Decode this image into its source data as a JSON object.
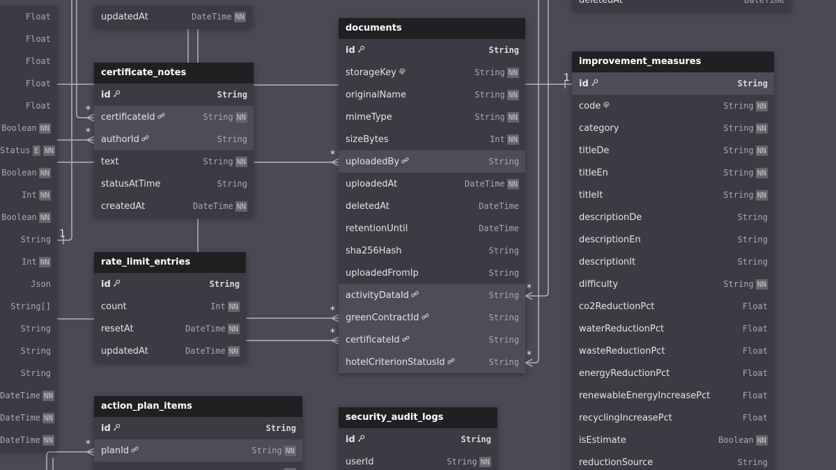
{
  "tables": {
    "partial_left": {
      "rows": [
        {
          "name": "",
          "type": "Float",
          "nn": false
        },
        {
          "name": "",
          "type": "Float",
          "nn": false
        },
        {
          "name": "",
          "type": "Float",
          "nn": false
        },
        {
          "name": "",
          "type": "Float",
          "nn": false
        },
        {
          "name": "",
          "type": "Float",
          "nn": false
        },
        {
          "name": "",
          "type": "Boolean",
          "nn": true
        },
        {
          "name": "",
          "type": "Status",
          "enum": "E",
          "nn": true
        },
        {
          "name": "",
          "type": "Boolean",
          "nn": true
        },
        {
          "name": "",
          "type": "Int",
          "nn": true
        },
        {
          "name": "",
          "type": "Boolean",
          "nn": true
        },
        {
          "name": "",
          "type": "String",
          "nn": false
        },
        {
          "name": "",
          "type": "Int",
          "nn": true
        },
        {
          "name": "",
          "type": "Json",
          "nn": false
        },
        {
          "name": "",
          "type": "String[]",
          "nn": false
        },
        {
          "name": "",
          "type": "String",
          "nn": false
        },
        {
          "name": "",
          "type": "String",
          "nn": false
        },
        {
          "name": "",
          "type": "String",
          "nn": false
        },
        {
          "name": "",
          "type": "DateTime",
          "nn": true
        },
        {
          "name": "",
          "type": "DateTime",
          "nn": true
        },
        {
          "name": "",
          "type": "DateTime",
          "nn": true
        }
      ]
    },
    "partial_top_left": {
      "rows": [
        {
          "name": "updatedAt",
          "type": "DateTime",
          "nn": true
        }
      ]
    },
    "partial_top_right": {
      "rows": [
        {
          "name": "deletedAt",
          "type": "DateTime",
          "nn": false
        }
      ]
    },
    "certificate_notes": {
      "title": "certificate_notes",
      "rows": [
        {
          "name": "id",
          "type": "String",
          "pk": true,
          "icon": "key"
        },
        {
          "name": "certificateId",
          "type": "String",
          "nn": true,
          "icon": "link",
          "hl": true
        },
        {
          "name": "authorId",
          "type": "String",
          "icon": "link",
          "hl": true
        },
        {
          "name": "text",
          "type": "String",
          "nn": true
        },
        {
          "name": "statusAtTime",
          "type": "String"
        },
        {
          "name": "createdAt",
          "type": "DateTime",
          "nn": true
        }
      ]
    },
    "documents": {
      "title": "documents",
      "rows": [
        {
          "name": "id",
          "type": "String",
          "pk": true,
          "icon": "key"
        },
        {
          "name": "storageKey",
          "type": "String",
          "nn": true,
          "icon": "fingerprint"
        },
        {
          "name": "originalName",
          "type": "String",
          "nn": true
        },
        {
          "name": "mimeType",
          "type": "String",
          "nn": true
        },
        {
          "name": "sizeBytes",
          "type": "Int",
          "nn": true
        },
        {
          "name": "uploadedBy",
          "type": "String",
          "icon": "link",
          "hl": true
        },
        {
          "name": "uploadedAt",
          "type": "DateTime",
          "nn": true
        },
        {
          "name": "deletedAt",
          "type": "DateTime"
        },
        {
          "name": "retentionUntil",
          "type": "DateTime"
        },
        {
          "name": "sha256Hash",
          "type": "String"
        },
        {
          "name": "uploadedFromIp",
          "type": "String"
        },
        {
          "name": "activityDataId",
          "type": "String",
          "icon": "link",
          "hl": true
        },
        {
          "name": "greenContractId",
          "type": "String",
          "icon": "link",
          "hl": true
        },
        {
          "name": "certificateId",
          "type": "String",
          "icon": "link",
          "hl": true
        },
        {
          "name": "hotelCriterionStatusId",
          "type": "String",
          "icon": "link",
          "hl": true
        }
      ]
    },
    "improvement_measures": {
      "title": "improvement_measures",
      "rows": [
        {
          "name": "id",
          "type": "String",
          "pk": true,
          "icon": "key",
          "hl": true
        },
        {
          "name": "code",
          "type": "String",
          "nn": true,
          "icon": "fingerprint"
        },
        {
          "name": "category",
          "type": "String",
          "nn": true
        },
        {
          "name": "titleDe",
          "type": "String",
          "nn": true
        },
        {
          "name": "titleEn",
          "type": "String",
          "nn": true
        },
        {
          "name": "titleIt",
          "type": "String",
          "nn": true
        },
        {
          "name": "descriptionDe",
          "type": "String"
        },
        {
          "name": "descriptionEn",
          "type": "String"
        },
        {
          "name": "descriptionIt",
          "type": "String"
        },
        {
          "name": "difficulty",
          "type": "String",
          "nn": true
        },
        {
          "name": "co2ReductionPct",
          "type": "Float"
        },
        {
          "name": "waterReductionPct",
          "type": "Float"
        },
        {
          "name": "wasteReductionPct",
          "type": "Float"
        },
        {
          "name": "energyReductionPct",
          "type": "Float"
        },
        {
          "name": "renewableEnergyIncreasePct",
          "type": "Float"
        },
        {
          "name": "recyclingIncreasePct",
          "type": "Float"
        },
        {
          "name": "isEstimate",
          "type": "Boolean",
          "nn": true
        },
        {
          "name": "reductionSource",
          "type": "String"
        }
      ]
    },
    "rate_limit_entries": {
      "title": "rate_limit_entries",
      "rows": [
        {
          "name": "id",
          "type": "String",
          "pk": true,
          "icon": "key"
        },
        {
          "name": "count",
          "type": "Int",
          "nn": true
        },
        {
          "name": "resetAt",
          "type": "DateTime",
          "nn": true
        },
        {
          "name": "updatedAt",
          "type": "DateTime",
          "nn": true
        }
      ]
    },
    "action_plan_items": {
      "title": "action_plan_items",
      "rows": [
        {
          "name": "id",
          "type": "String",
          "pk": true,
          "icon": "key"
        },
        {
          "name": "planId",
          "type": "String",
          "nn": true,
          "icon": "link",
          "hl": true
        },
        {
          "name": "",
          "type": "",
          "nn": true
        }
      ]
    },
    "security_audit_logs": {
      "title": "security_audit_logs",
      "rows": [
        {
          "name": "id",
          "type": "String",
          "pk": true,
          "icon": "key"
        },
        {
          "name": "userId",
          "type": "String",
          "nn": true
        }
      ]
    }
  },
  "cardinality": {
    "many": "*",
    "one": "1"
  },
  "badges": {
    "nn": "NN",
    "enum": "E"
  },
  "icons": {
    "key": "key-icon",
    "link": "link-icon",
    "fingerprint": "fingerprint-icon"
  },
  "colors": {
    "canvas": "#4a4a55",
    "card": "#3b3b43",
    "header": "#202022",
    "highlight": "#4d4d57",
    "edge": "#b4b4bc"
  }
}
